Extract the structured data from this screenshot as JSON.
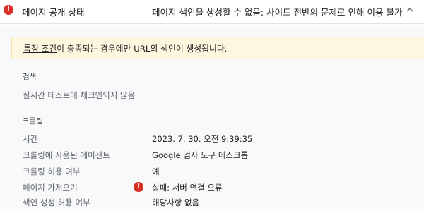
{
  "header": {
    "label": "페이지 공개 상태",
    "value": "페이지 색인을 생성할 수 없음: 사이트 전반의 문제로 인해 이용 불가",
    "status_icon": "error-icon",
    "toggle_icon": "chevron-up-icon"
  },
  "notice": {
    "link_text": "특정 조건",
    "text": "이 충족되는 경우에만 URL의 색인이 생성됩니다."
  },
  "search": {
    "title": "검색",
    "status": "실시간 테스트에 체크인되지 않음"
  },
  "crawling": {
    "title": "크롤링",
    "rows": [
      {
        "label": "시간",
        "value": "2023. 7. 30. 오전 9:39:35"
      },
      {
        "label": "크롤링에 사용된 에이전트",
        "value": "Google 검사 도구 데스크톱"
      },
      {
        "label": "크롤링 허용 여부",
        "value": "예"
      },
      {
        "label": "페이지 가져오기",
        "value": "실패: 서버 연결 오류",
        "icon": "error-icon"
      },
      {
        "label": "색인 생성 허용 여부",
        "value": "해당사항 없음"
      }
    ]
  },
  "colors": {
    "error": "#d93025",
    "notice_bg": "#fef7e0",
    "panel_bg": "#f8f9fa"
  }
}
